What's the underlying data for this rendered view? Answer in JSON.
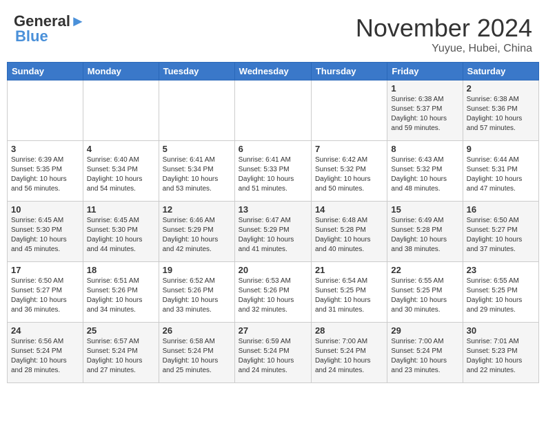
{
  "header": {
    "logo_general": "General",
    "logo_blue": "Blue",
    "month_title": "November 2024",
    "location": "Yuyue, Hubei, China"
  },
  "days_of_week": [
    "Sunday",
    "Monday",
    "Tuesday",
    "Wednesday",
    "Thursday",
    "Friday",
    "Saturday"
  ],
  "weeks": [
    [
      {
        "num": "",
        "info": ""
      },
      {
        "num": "",
        "info": ""
      },
      {
        "num": "",
        "info": ""
      },
      {
        "num": "",
        "info": ""
      },
      {
        "num": "",
        "info": ""
      },
      {
        "num": "1",
        "info": "Sunrise: 6:38 AM\nSunset: 5:37 PM\nDaylight: 10 hours\nand 59 minutes."
      },
      {
        "num": "2",
        "info": "Sunrise: 6:38 AM\nSunset: 5:36 PM\nDaylight: 10 hours\nand 57 minutes."
      }
    ],
    [
      {
        "num": "3",
        "info": "Sunrise: 6:39 AM\nSunset: 5:35 PM\nDaylight: 10 hours\nand 56 minutes."
      },
      {
        "num": "4",
        "info": "Sunrise: 6:40 AM\nSunset: 5:34 PM\nDaylight: 10 hours\nand 54 minutes."
      },
      {
        "num": "5",
        "info": "Sunrise: 6:41 AM\nSunset: 5:34 PM\nDaylight: 10 hours\nand 53 minutes."
      },
      {
        "num": "6",
        "info": "Sunrise: 6:41 AM\nSunset: 5:33 PM\nDaylight: 10 hours\nand 51 minutes."
      },
      {
        "num": "7",
        "info": "Sunrise: 6:42 AM\nSunset: 5:32 PM\nDaylight: 10 hours\nand 50 minutes."
      },
      {
        "num": "8",
        "info": "Sunrise: 6:43 AM\nSunset: 5:32 PM\nDaylight: 10 hours\nand 48 minutes."
      },
      {
        "num": "9",
        "info": "Sunrise: 6:44 AM\nSunset: 5:31 PM\nDaylight: 10 hours\nand 47 minutes."
      }
    ],
    [
      {
        "num": "10",
        "info": "Sunrise: 6:45 AM\nSunset: 5:30 PM\nDaylight: 10 hours\nand 45 minutes."
      },
      {
        "num": "11",
        "info": "Sunrise: 6:45 AM\nSunset: 5:30 PM\nDaylight: 10 hours\nand 44 minutes."
      },
      {
        "num": "12",
        "info": "Sunrise: 6:46 AM\nSunset: 5:29 PM\nDaylight: 10 hours\nand 42 minutes."
      },
      {
        "num": "13",
        "info": "Sunrise: 6:47 AM\nSunset: 5:29 PM\nDaylight: 10 hours\nand 41 minutes."
      },
      {
        "num": "14",
        "info": "Sunrise: 6:48 AM\nSunset: 5:28 PM\nDaylight: 10 hours\nand 40 minutes."
      },
      {
        "num": "15",
        "info": "Sunrise: 6:49 AM\nSunset: 5:28 PM\nDaylight: 10 hours\nand 38 minutes."
      },
      {
        "num": "16",
        "info": "Sunrise: 6:50 AM\nSunset: 5:27 PM\nDaylight: 10 hours\nand 37 minutes."
      }
    ],
    [
      {
        "num": "17",
        "info": "Sunrise: 6:50 AM\nSunset: 5:27 PM\nDaylight: 10 hours\nand 36 minutes."
      },
      {
        "num": "18",
        "info": "Sunrise: 6:51 AM\nSunset: 5:26 PM\nDaylight: 10 hours\nand 34 minutes."
      },
      {
        "num": "19",
        "info": "Sunrise: 6:52 AM\nSunset: 5:26 PM\nDaylight: 10 hours\nand 33 minutes."
      },
      {
        "num": "20",
        "info": "Sunrise: 6:53 AM\nSunset: 5:26 PM\nDaylight: 10 hours\nand 32 minutes."
      },
      {
        "num": "21",
        "info": "Sunrise: 6:54 AM\nSunset: 5:25 PM\nDaylight: 10 hours\nand 31 minutes."
      },
      {
        "num": "22",
        "info": "Sunrise: 6:55 AM\nSunset: 5:25 PM\nDaylight: 10 hours\nand 30 minutes."
      },
      {
        "num": "23",
        "info": "Sunrise: 6:55 AM\nSunset: 5:25 PM\nDaylight: 10 hours\nand 29 minutes."
      }
    ],
    [
      {
        "num": "24",
        "info": "Sunrise: 6:56 AM\nSunset: 5:24 PM\nDaylight: 10 hours\nand 28 minutes."
      },
      {
        "num": "25",
        "info": "Sunrise: 6:57 AM\nSunset: 5:24 PM\nDaylight: 10 hours\nand 27 minutes."
      },
      {
        "num": "26",
        "info": "Sunrise: 6:58 AM\nSunset: 5:24 PM\nDaylight: 10 hours\nand 25 minutes."
      },
      {
        "num": "27",
        "info": "Sunrise: 6:59 AM\nSunset: 5:24 PM\nDaylight: 10 hours\nand 24 minutes."
      },
      {
        "num": "28",
        "info": "Sunrise: 7:00 AM\nSunset: 5:24 PM\nDaylight: 10 hours\nand 24 minutes."
      },
      {
        "num": "29",
        "info": "Sunrise: 7:00 AM\nSunset: 5:24 PM\nDaylight: 10 hours\nand 23 minutes."
      },
      {
        "num": "30",
        "info": "Sunrise: 7:01 AM\nSunset: 5:23 PM\nDaylight: 10 hours\nand 22 minutes."
      }
    ]
  ]
}
